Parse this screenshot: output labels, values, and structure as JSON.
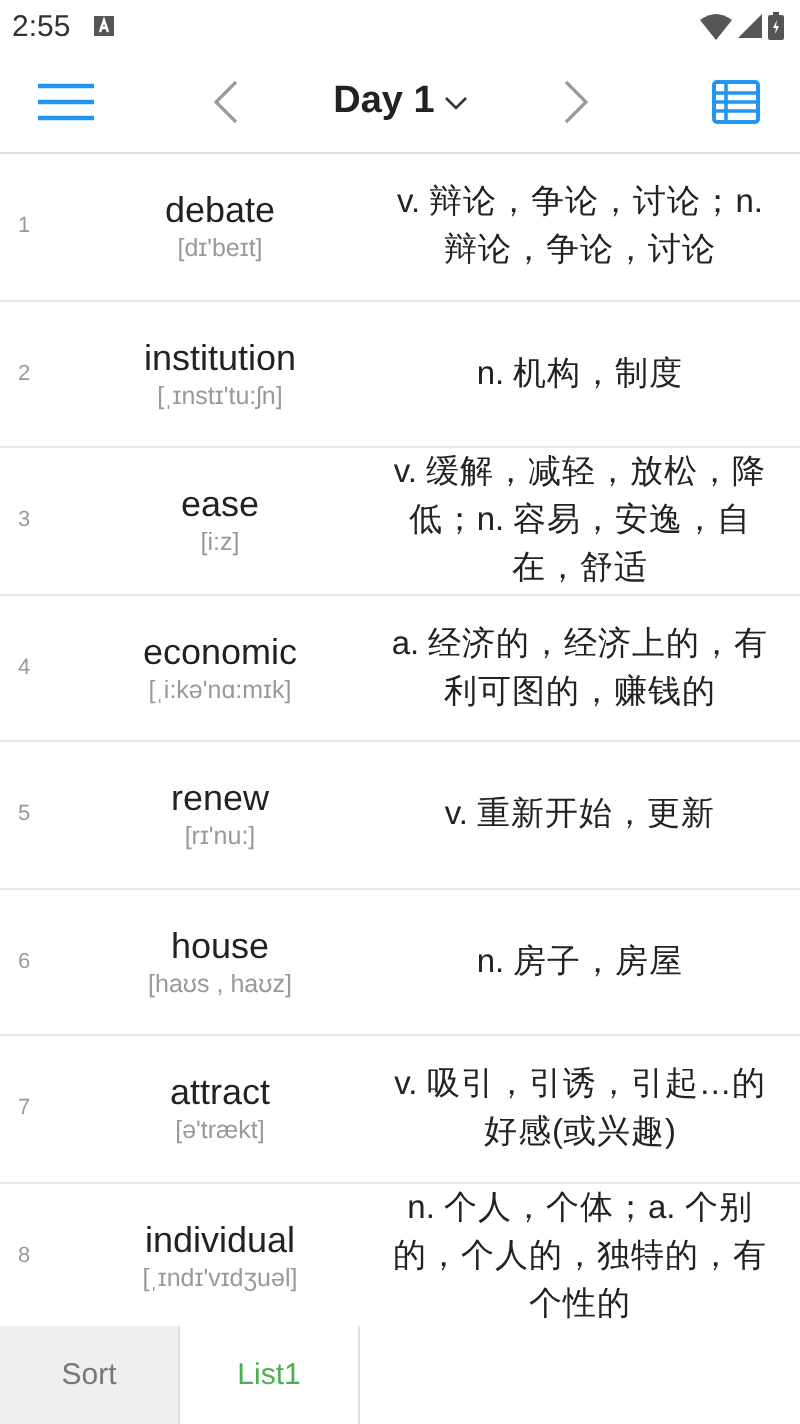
{
  "status_bar": {
    "time": "2:55"
  },
  "toolbar": {
    "title": "Day 1"
  },
  "words": [
    {
      "index": "1",
      "word": "debate",
      "phonetic": "[dɪ'beɪt]",
      "meaning": "v. 辩论，争论，讨论；n. 辩论，争论，讨论"
    },
    {
      "index": "2",
      "word": "institution",
      "phonetic": "[ˌɪnstɪ'tu:ʃn]",
      "meaning": "n. 机构，制度"
    },
    {
      "index": "3",
      "word": "ease",
      "phonetic": "[i:z]",
      "meaning": "v. 缓解，减轻，放松，降低；n. 容易，安逸，自在，舒适"
    },
    {
      "index": "4",
      "word": "economic",
      "phonetic": "[ˌi:kə'nɑ:mɪk]",
      "meaning": "a. 经济的，经济上的，有利可图的，赚钱的"
    },
    {
      "index": "5",
      "word": "renew",
      "phonetic": "[rɪ'nu:]",
      "meaning": "v. 重新开始，更新"
    },
    {
      "index": "6",
      "word": "house",
      "phonetic": "[haʊs , haʊz]",
      "meaning": "n. 房子，房屋"
    },
    {
      "index": "7",
      "word": "attract",
      "phonetic": "[ə'trækt]",
      "meaning": "v. 吸引，引诱，引起…的好感(或兴趣)"
    },
    {
      "index": "8",
      "word": "individual",
      "phonetic": "[ˌɪndɪ'vɪdʒuəl]",
      "meaning": "n. 个人，个体；a. 个别的，个人的，独特的，有个性的"
    }
  ],
  "tabs": [
    {
      "label": "Sort",
      "selected": false
    },
    {
      "label": "List1",
      "selected": true
    }
  ]
}
